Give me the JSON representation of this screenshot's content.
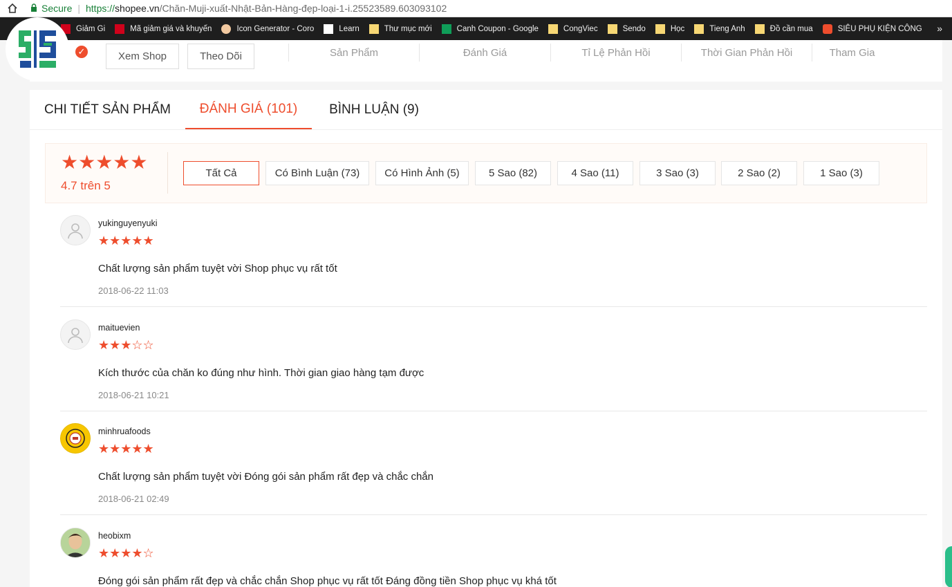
{
  "browser": {
    "secure_label": "Secure",
    "url_proto": "https://",
    "url_host": "shopee.vn",
    "url_path": "/Chăn-Muji-xuất-Nhật-Bản-Hàng-đẹp-loại-1-i.25523589.603093102"
  },
  "bookmarks": [
    {
      "label": "Giảm Gi",
      "icon": "mgg-icon"
    },
    {
      "label": "Mã giảm giá và khuyến",
      "icon": "mgg-icon"
    },
    {
      "label": "Icon Generator - Coro",
      "icon": "face-icon"
    },
    {
      "label": "Learn",
      "icon": "page-icon"
    },
    {
      "label": "Thư mục mới",
      "icon": "folder-icon"
    },
    {
      "label": "Canh Coupon - Google",
      "icon": "sheet-icon"
    },
    {
      "label": "CongViec",
      "icon": "folder-icon"
    },
    {
      "label": "Sendo",
      "icon": "folder-icon"
    },
    {
      "label": "Học",
      "icon": "folder-icon"
    },
    {
      "label": "Tieng Anh",
      "icon": "folder-icon"
    },
    {
      "label": "Đồ cần mua",
      "icon": "folder-icon"
    },
    {
      "label": "SIÊU PHỤ KIỆN CÔNG",
      "icon": "shopee-icon"
    }
  ],
  "bookmarks_more": "»",
  "shop": {
    "view_shop": "Xem Shop",
    "follow": "Theo Dõi",
    "stats": [
      "Sản Phẩm",
      "Đánh Giá",
      "Tỉ Lệ Phản Hồi",
      "Thời Gian Phản Hồi",
      "Tham Gia"
    ]
  },
  "tabs": [
    {
      "label": "CHI TIẾT SẢN PHẨM",
      "active": false
    },
    {
      "label": "ĐÁNH GIÁ (101)",
      "active": true
    },
    {
      "label": "BÌNH LUẬN (9)",
      "active": false
    }
  ],
  "rating": {
    "stars": "★★★★★",
    "text": "4.7 trên 5",
    "value": 4.7
  },
  "filters": [
    {
      "label": "Tất Cả",
      "selected": true
    },
    {
      "label": "Có Bình Luận (73)",
      "selected": false
    },
    {
      "label": "Có Hình Ảnh (5)",
      "selected": false
    },
    {
      "label": "5 Sao (82)",
      "selected": false
    },
    {
      "label": "4 Sao (11)",
      "selected": false
    },
    {
      "label": "3 Sao (3)",
      "selected": false
    },
    {
      "label": "2 Sao (2)",
      "selected": false
    },
    {
      "label": "1 Sao (3)",
      "selected": false
    }
  ],
  "reviews": [
    {
      "user": "yukinguyenyuki",
      "stars": "★★★★★",
      "rating": 5,
      "comment": " Chất lượng sản phẩm tuyệt vời Shop phục vụ rất tốt",
      "date": "2018-06-22 11:03",
      "avatar": "default-avatar-icon"
    },
    {
      "user": "maituevien",
      "stars": "★★★☆☆",
      "rating": 3,
      "comment": "Kích thước của chăn ko đúng như hình. Thời gian giao hàng tạm được",
      "date": "2018-06-21 10:21",
      "avatar": "default-avatar-icon"
    },
    {
      "user": "minhruafoods",
      "stars": "★★★★★",
      "rating": 5,
      "comment": " Chất lượng sản phẩm tuyệt vời Đóng gói sản phẩm rất đẹp và chắc chắn",
      "date": "2018-06-21 02:49",
      "avatar": "shop-logo-avatar"
    },
    {
      "user": "heobixm",
      "stars": "★★★★☆",
      "rating": 4,
      "comment": " Đóng gói sản phẩm rất đẹp và chắc chắn Shop phục vụ rất tốt Đáng đồng tiền Shop phục vụ khá tốt",
      "date": "",
      "avatar": "photo-avatar"
    }
  ],
  "colors": {
    "accent": "#ee4d2d",
    "logo_green": "#2bae66",
    "logo_blue": "#1f4e9c"
  }
}
